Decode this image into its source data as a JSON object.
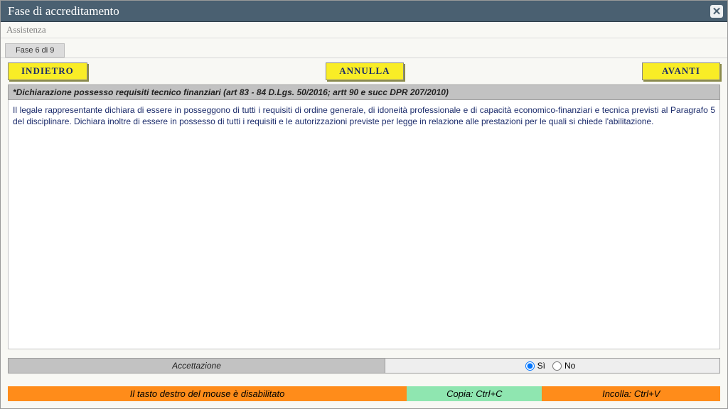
{
  "window": {
    "title": "Fase di accreditamento"
  },
  "menu": {
    "assist": "Assistenza"
  },
  "tab": {
    "label": "Fase 6 di 9"
  },
  "buttons": {
    "back": "INDIETRO",
    "cancel": "ANNULLA",
    "next": "AVANTI"
  },
  "section": {
    "header": "*Dichiarazione possesso requisiti tecnico finanziari (art 83 - 84 D.Lgs. 50/2016; artt 90 e succ DPR 207/2010)",
    "body": "Il legale rappresentante dichiara di essere in posseggono di tutti i requisiti di ordine generale, di idoneità professionale e di capacità economico-finanziari e tecnica previsti al Paragrafo 5 del disciplinare. Dichiara inoltre di essere in possesso di tutti i requisiti e le autorizzazioni previste per legge in relazione alle prestazioni per le quali si chiede l'abilitazione."
  },
  "accept": {
    "label": "Accettazione",
    "yes": "Sì",
    "no": "No"
  },
  "footer": {
    "disabled_right_click": "Il tasto destro del mouse è disabilitato",
    "copy": "Copia: Ctrl+C",
    "paste": "Incolla: Ctrl+V"
  }
}
